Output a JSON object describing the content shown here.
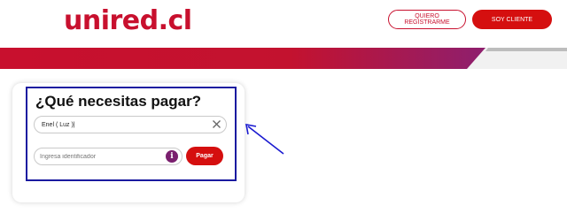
{
  "header": {
    "logo_text": "unired.cl",
    "register_label": "QUIERO REGISTRARME",
    "client_label": "SOY CLIENTE"
  },
  "payment_card": {
    "title": "¿Qué necesitas pagar?",
    "service_value": "Enel ( Luz )|",
    "identifier_placeholder": "Ingresa identificador",
    "info_icon_text": "i",
    "pay_label": "Pagar"
  },
  "colors": {
    "brand_red": "#d50f0f",
    "banner_gradient": [
      "#c8102e",
      "#8e1f6e"
    ],
    "info_purple": "#7a1f6e",
    "highlight_blue": "#1a1aa0"
  },
  "icons": [
    "close-icon",
    "info-icon",
    "annotation-arrow"
  ]
}
